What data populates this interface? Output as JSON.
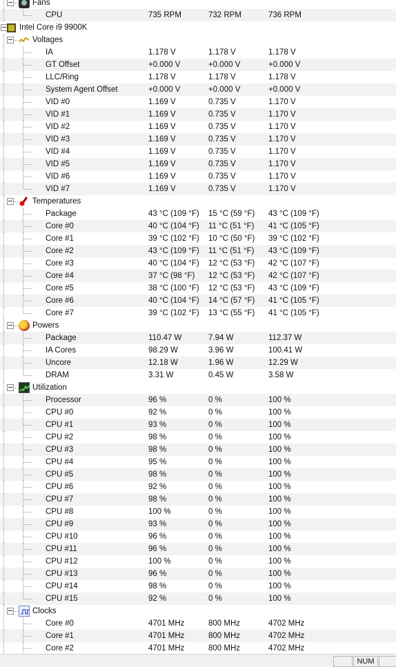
{
  "sections": [
    {
      "title": "Fans",
      "icon": "fan-icon",
      "rows": [
        {
          "label": "CPU",
          "v": [
            "735 RPM",
            "732 RPM",
            "736 RPM"
          ]
        }
      ]
    },
    {
      "title": "Intel Core i9 9900K",
      "icon": "cpu-chip-icon",
      "root": true
    },
    {
      "title": "Voltages",
      "icon": "voltage-icon",
      "rows": [
        {
          "label": "IA",
          "v": [
            "1.178 V",
            "1.178 V",
            "1.178 V"
          ]
        },
        {
          "label": "GT Offset",
          "v": [
            "+0.000 V",
            "+0.000 V",
            "+0.000 V"
          ]
        },
        {
          "label": "LLC/Ring",
          "v": [
            "1.178 V",
            "1.178 V",
            "1.178 V"
          ]
        },
        {
          "label": "System Agent Offset",
          "v": [
            "+0.000 V",
            "+0.000 V",
            "+0.000 V"
          ]
        },
        {
          "label": "VID #0",
          "v": [
            "1.169 V",
            "0.735 V",
            "1.170 V"
          ]
        },
        {
          "label": "VID #1",
          "v": [
            "1.169 V",
            "0.735 V",
            "1.170 V"
          ]
        },
        {
          "label": "VID #2",
          "v": [
            "1.169 V",
            "0.735 V",
            "1.170 V"
          ]
        },
        {
          "label": "VID #3",
          "v": [
            "1.169 V",
            "0.735 V",
            "1.170 V"
          ]
        },
        {
          "label": "VID #4",
          "v": [
            "1.169 V",
            "0.735 V",
            "1.170 V"
          ]
        },
        {
          "label": "VID #5",
          "v": [
            "1.169 V",
            "0.735 V",
            "1.170 V"
          ]
        },
        {
          "label": "VID #6",
          "v": [
            "1.169 V",
            "0.735 V",
            "1.170 V"
          ]
        },
        {
          "label": "VID #7",
          "v": [
            "1.169 V",
            "0.735 V",
            "1.170 V"
          ]
        }
      ]
    },
    {
      "title": "Temperatures",
      "icon": "thermometer-icon",
      "rows": [
        {
          "label": "Package",
          "v": [
            "43 °C  (109 °F)",
            "15 °C  (59 °F)",
            "43 °C  (109 °F)"
          ]
        },
        {
          "label": "Core #0",
          "v": [
            "40 °C  (104 °F)",
            "11 °C  (51 °F)",
            "41 °C  (105 °F)"
          ]
        },
        {
          "label": "Core #1",
          "v": [
            "39 °C  (102 °F)",
            "10 °C  (50 °F)",
            "39 °C  (102 °F)"
          ]
        },
        {
          "label": "Core #2",
          "v": [
            "43 °C  (109 °F)",
            "11 °C  (51 °F)",
            "43 °C  (109 °F)"
          ]
        },
        {
          "label": "Core #3",
          "v": [
            "40 °C  (104 °F)",
            "12 °C  (53 °F)",
            "42 °C  (107 °F)"
          ]
        },
        {
          "label": "Core #4",
          "v": [
            "37 °C  (98 °F)",
            "12 °C  (53 °F)",
            "42 °C  (107 °F)"
          ]
        },
        {
          "label": "Core #5",
          "v": [
            "38 °C  (100 °F)",
            "12 °C  (53 °F)",
            "43 °C  (109 °F)"
          ]
        },
        {
          "label": "Core #6",
          "v": [
            "40 °C  (104 °F)",
            "14 °C  (57 °F)",
            "41 °C  (105 °F)"
          ]
        },
        {
          "label": "Core #7",
          "v": [
            "39 °C  (102 °F)",
            "13 °C  (55 °F)",
            "41 °C  (105 °F)"
          ]
        }
      ]
    },
    {
      "title": "Powers",
      "icon": "power-icon",
      "rows": [
        {
          "label": "Package",
          "v": [
            "110.47 W",
            "7.94 W",
            "112.37 W"
          ]
        },
        {
          "label": "IA Cores",
          "v": [
            "98.29 W",
            "3.96 W",
            "100.41 W"
          ]
        },
        {
          "label": "Uncore",
          "v": [
            "12.18 W",
            "1.96 W",
            "12.29 W"
          ]
        },
        {
          "label": "DRAM",
          "v": [
            "3.31 W",
            "0.45 W",
            "3.58 W"
          ]
        }
      ]
    },
    {
      "title": "Utilization",
      "icon": "utilization-icon",
      "rows": [
        {
          "label": "Processor",
          "v": [
            "96 %",
            "0 %",
            "100 %"
          ]
        },
        {
          "label": "CPU #0",
          "v": [
            "92 %",
            "0 %",
            "100 %"
          ]
        },
        {
          "label": "CPU #1",
          "v": [
            "93 %",
            "0 %",
            "100 %"
          ]
        },
        {
          "label": "CPU #2",
          "v": [
            "98 %",
            "0 %",
            "100 %"
          ]
        },
        {
          "label": "CPU #3",
          "v": [
            "98 %",
            "0 %",
            "100 %"
          ]
        },
        {
          "label": "CPU #4",
          "v": [
            "95 %",
            "0 %",
            "100 %"
          ]
        },
        {
          "label": "CPU #5",
          "v": [
            "98 %",
            "0 %",
            "100 %"
          ]
        },
        {
          "label": "CPU #6",
          "v": [
            "92 %",
            "0 %",
            "100 %"
          ]
        },
        {
          "label": "CPU #7",
          "v": [
            "98 %",
            "0 %",
            "100 %"
          ]
        },
        {
          "label": "CPU #8",
          "v": [
            "100 %",
            "0 %",
            "100 %"
          ]
        },
        {
          "label": "CPU #9",
          "v": [
            "93 %",
            "0 %",
            "100 %"
          ]
        },
        {
          "label": "CPU #10",
          "v": [
            "96 %",
            "0 %",
            "100 %"
          ]
        },
        {
          "label": "CPU #11",
          "v": [
            "96 %",
            "0 %",
            "100 %"
          ]
        },
        {
          "label": "CPU #12",
          "v": [
            "100 %",
            "0 %",
            "100 %"
          ]
        },
        {
          "label": "CPU #13",
          "v": [
            "96 %",
            "0 %",
            "100 %"
          ]
        },
        {
          "label": "CPU #14",
          "v": [
            "98 %",
            "0 %",
            "100 %"
          ]
        },
        {
          "label": "CPU #15",
          "v": [
            "92 %",
            "0 %",
            "100 %"
          ]
        }
      ]
    },
    {
      "title": "Clocks",
      "icon": "clock-icon",
      "rows": [
        {
          "label": "Core #0",
          "v": [
            "4701 MHz",
            "800 MHz",
            "4702 MHz"
          ]
        },
        {
          "label": "Core #1",
          "v": [
            "4701 MHz",
            "800 MHz",
            "4702 MHz"
          ]
        },
        {
          "label": "Core #2",
          "v": [
            "4701 MHz",
            "800 MHz",
            "4702 MHz"
          ]
        }
      ]
    }
  ],
  "statusbar": {
    "num": "NUM"
  }
}
